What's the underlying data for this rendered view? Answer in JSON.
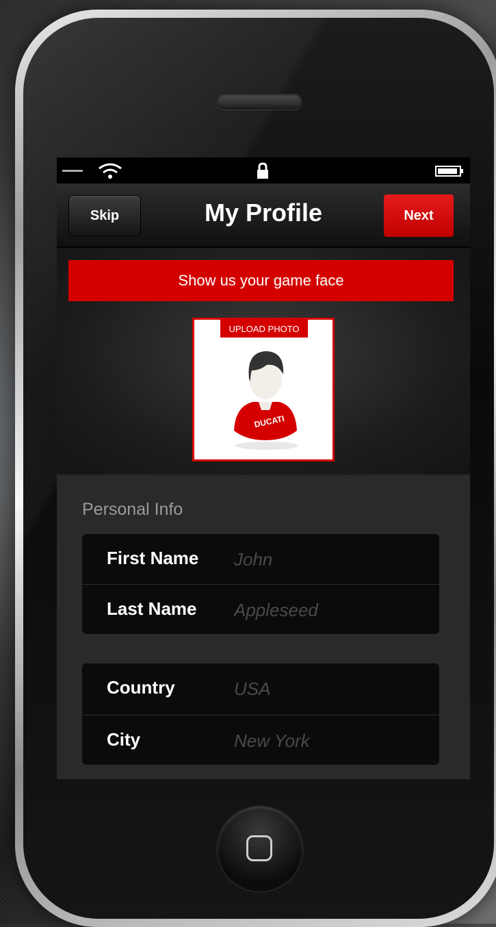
{
  "navbar": {
    "title": "My Profile",
    "skip_label": "Skip",
    "next_label": "Next"
  },
  "banner": {
    "text": "Show us your game face"
  },
  "photo": {
    "upload_label": "UPLOAD PHOTO",
    "shirt_text": "DUCATI"
  },
  "personal_info": {
    "section_label": "Personal Info",
    "fields": [
      {
        "label": "First Name",
        "placeholder": "John",
        "value": ""
      },
      {
        "label": "Last Name",
        "placeholder": "Appleseed",
        "value": ""
      }
    ]
  },
  "location": {
    "fields": [
      {
        "label": "Country",
        "placeholder": "USA",
        "value": ""
      },
      {
        "label": "City",
        "placeholder": "New York",
        "value": ""
      }
    ]
  },
  "colors": {
    "accent": "#d40000",
    "background": "#1e1e1e",
    "field_bg": "#0b0b0b",
    "placeholder": "#4a4a4a"
  },
  "icons": [
    "wifi-icon",
    "lock-icon",
    "battery-icon",
    "user-avatar-icon",
    "home-button-icon"
  ]
}
